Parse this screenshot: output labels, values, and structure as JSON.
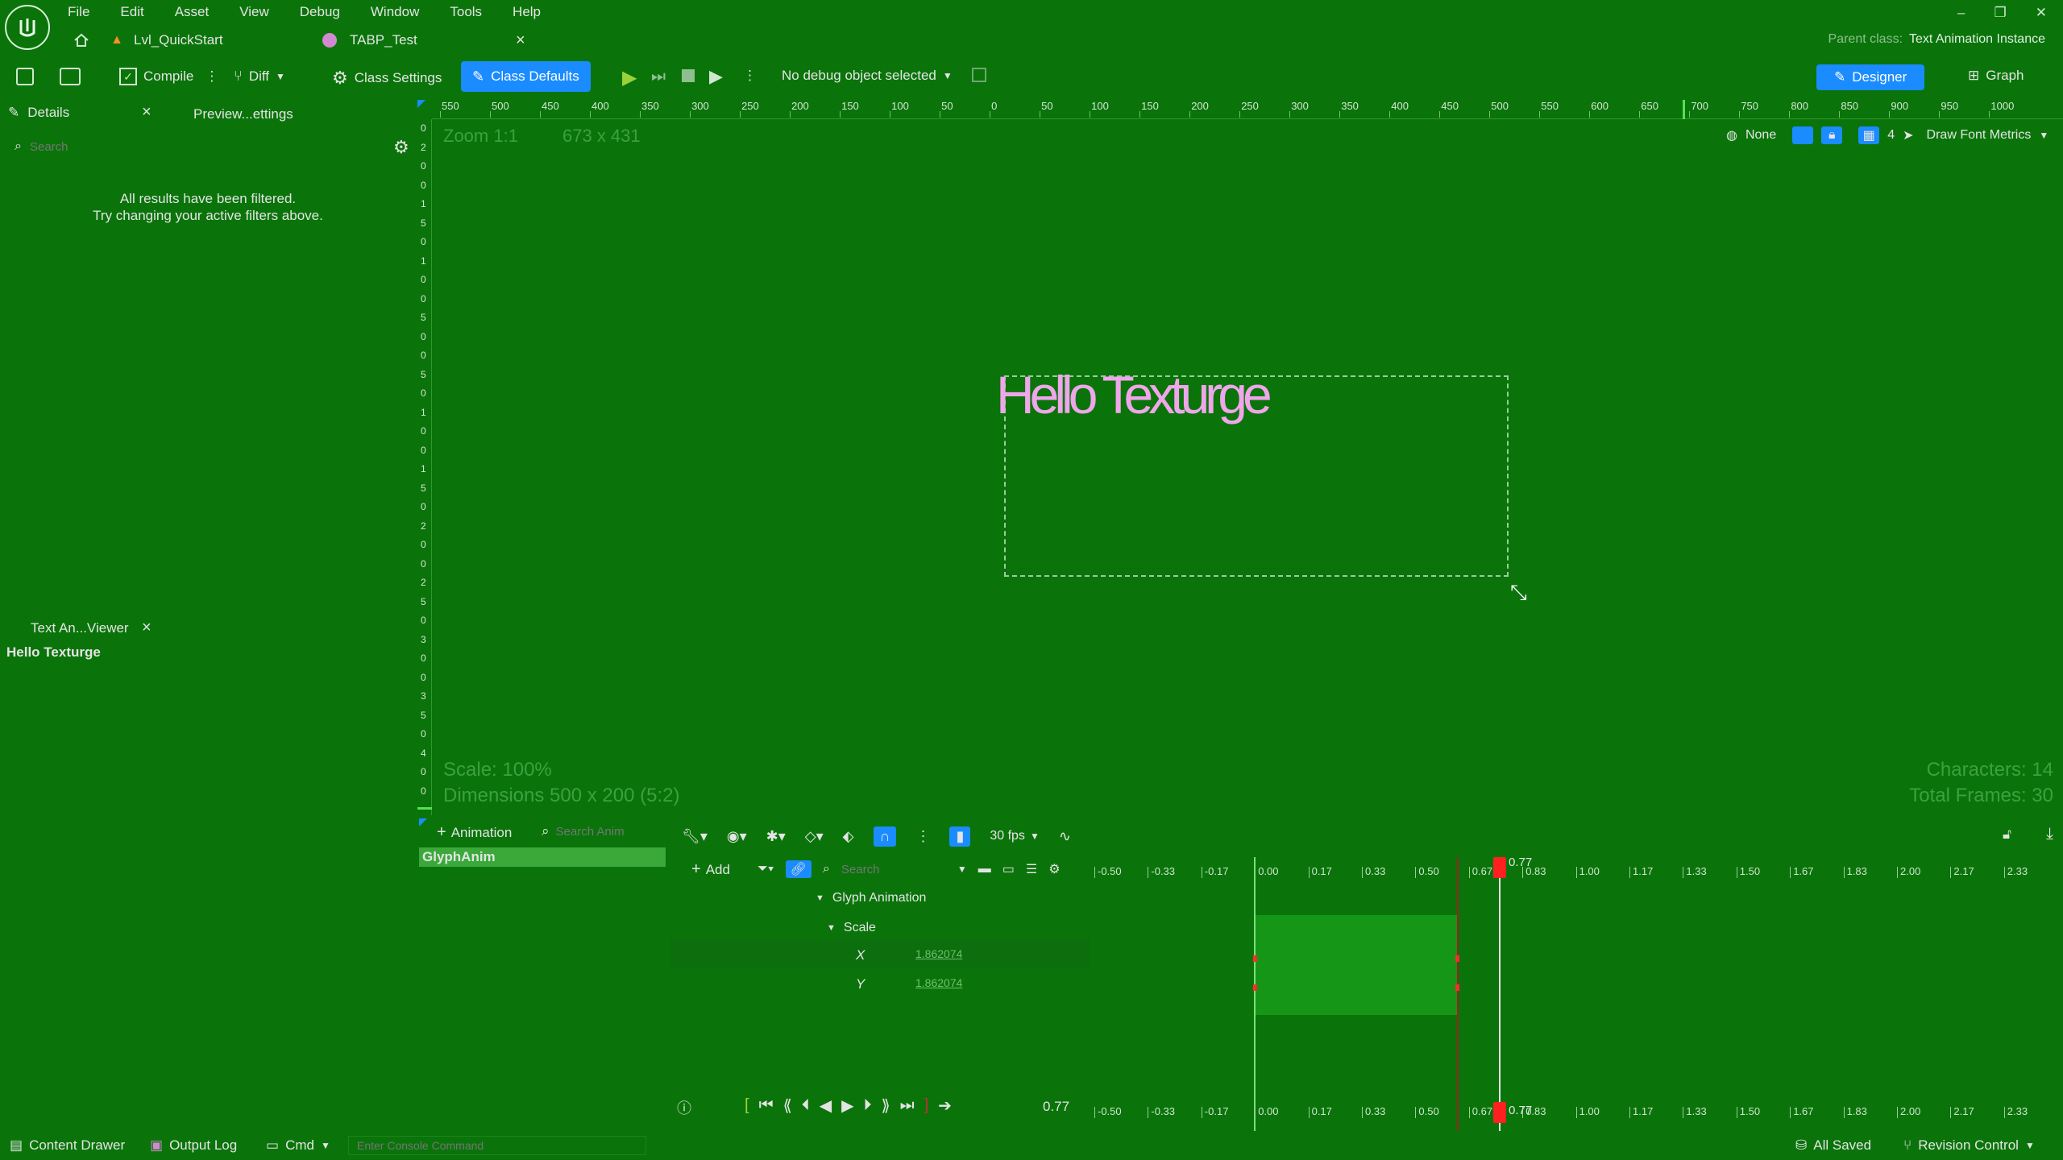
{
  "menu": [
    "File",
    "Edit",
    "Asset",
    "View",
    "Debug",
    "Window",
    "Tools",
    "Help"
  ],
  "tabs": [
    {
      "label": "Lvl_QuickStart"
    },
    {
      "label": "TABP_Test",
      "close": "×"
    }
  ],
  "parent_class": {
    "label": "Parent class:",
    "value": "Text Animation Instance"
  },
  "toolbar": {
    "compile": "Compile",
    "diff": "Diff",
    "class_settings": "Class Settings",
    "class_defaults": "Class Defaults",
    "debug_object": "No debug object selected",
    "designer": "Designer",
    "graph": "Graph"
  },
  "details": {
    "tab": "Details",
    "tab_close": "×",
    "preview_tab": "Preview...ettings",
    "search_placeholder": "Search",
    "filtered_line1": "All results have been filtered.",
    "filtered_line2": "Try changing your active filters above."
  },
  "viewer": {
    "tab": "Text An...Viewer",
    "tab_close": "×",
    "text": "Hello Texturge"
  },
  "viewport": {
    "zoom": "Zoom 1:1",
    "resolution": "673 x 431",
    "none_label": "None",
    "grid_value": "4",
    "draw_font_metrics": "Draw Font Metrics",
    "preview_text": "Hello Texturge",
    "scale": "Scale: 100%",
    "dimensions": "Dimensions 500 x 200 (5:2)",
    "characters": "Characters: 14",
    "total_frames": "Total Frames: 30"
  },
  "ruler_labels": [
    "550",
    "500",
    "450",
    "400",
    "350",
    "300",
    "250",
    "200",
    "150",
    "100",
    "50",
    "0",
    "50",
    "100",
    "150",
    "200",
    "250",
    "300",
    "350",
    "400",
    "450",
    "500",
    "550",
    "600",
    "650",
    "700",
    "750",
    "800",
    "850",
    "900",
    "950",
    "1000"
  ],
  "vruler_labels": [
    "0",
    "2",
    "0",
    "0",
    "1",
    "5",
    "0",
    "1",
    "0",
    "0",
    "5",
    "0",
    "0",
    "5",
    "0",
    "1",
    "0",
    "0",
    "1",
    "5",
    "0",
    "2",
    "0",
    "0",
    "2",
    "5",
    "0",
    "3",
    "0",
    "0",
    "3",
    "5",
    "0",
    "4",
    "0",
    "0"
  ],
  "animation_list": {
    "add_label": "Animation",
    "search_placeholder": "Search Anim",
    "items": [
      "GlyphAnim"
    ]
  },
  "sequencer": {
    "fps": "30 fps",
    "add_label": "Add",
    "search_placeholder": "Search",
    "track_group": "Glyph Animation",
    "track": "Scale",
    "x_label": "X",
    "x_value": "1.862074",
    "y_label": "Y",
    "y_value": "1.862074",
    "time_labels": [
      "-0.50",
      "-0.33",
      "-0.17",
      "0.00",
      "0.17",
      "0.33",
      "0.50",
      "0.67",
      "0.83",
      "1.00",
      "1.17",
      "1.33",
      "1.50",
      "1.67",
      "1.83",
      "2.00",
      "2.17",
      "2.33"
    ],
    "playhead_value": "0.77",
    "current_time": "0.77"
  },
  "statusbar": {
    "content_drawer": "Content Drawer",
    "output_log": "Output Log",
    "cmd": "Cmd",
    "console_placeholder": "Enter Console Command",
    "all_saved": "All Saved",
    "revision_control": "Revision Control"
  },
  "colors": {
    "background": "#0a740a",
    "accent": "#1a8cff",
    "playhead": "#ff2020",
    "preview_text": "#f0a6ea",
    "selection": "#3aa93a"
  }
}
